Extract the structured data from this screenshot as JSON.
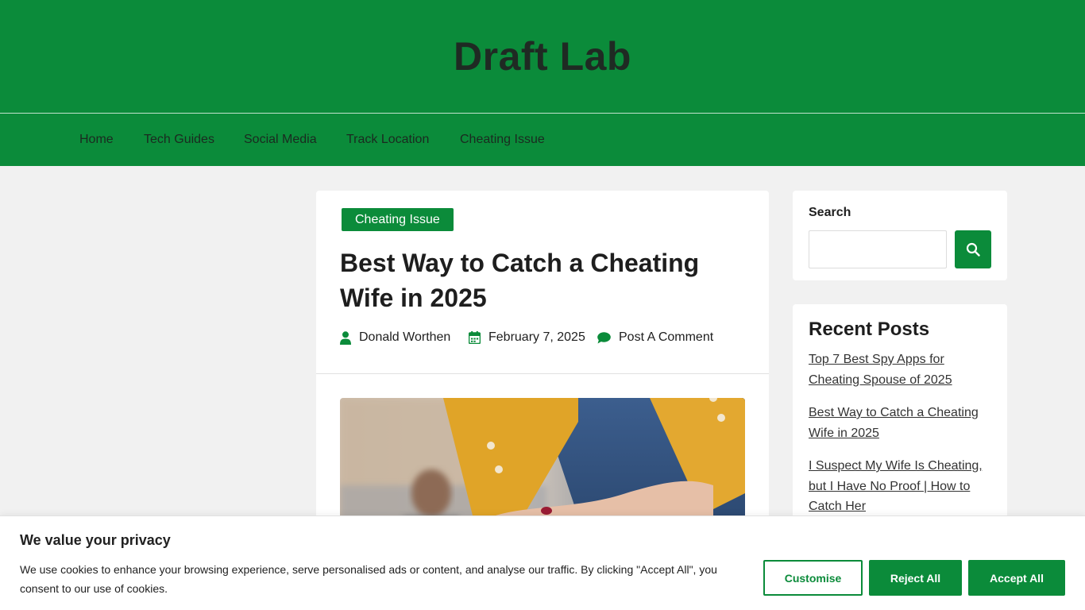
{
  "site": {
    "title": "Draft Lab"
  },
  "nav": {
    "items": [
      {
        "label": "Home"
      },
      {
        "label": "Tech Guides"
      },
      {
        "label": "Social Media"
      },
      {
        "label": "Track Location"
      },
      {
        "label": "Cheating Issue"
      }
    ]
  },
  "post": {
    "category": "Cheating Issue",
    "title": "Best Way to Catch a Cheating Wife in 2025",
    "author": "Donald Worthen",
    "date": "February 7, 2025",
    "comment_link": "Post A Comment",
    "author_icon": "user-icon",
    "date_icon": "calendar-icon",
    "comment_icon": "comment-icon"
  },
  "sidebar": {
    "search": {
      "label": "Search",
      "placeholder": "",
      "button_icon": "search-icon"
    },
    "recent": {
      "title": "Recent Posts",
      "items": [
        {
          "label": "Top 7 Best Spy Apps for Cheating Spouse of 2025"
        },
        {
          "label": "Best Way to Catch a Cheating Wife in 2025"
        },
        {
          "label": "I Suspect My Wife Is Cheating, but I Have No Proof | How to Catch Her"
        }
      ]
    }
  },
  "cookie": {
    "title": "We value your privacy",
    "text": "We use cookies to enhance your browsing experience, serve personalised ads or content, and analyse our traffic. By clicking \"Accept All\", you consent to our use of cookies.",
    "customise_label": "Customise",
    "reject_label": "Reject All",
    "accept_label": "Accept All"
  },
  "colors": {
    "brand": "#0b8b3a",
    "background": "#f1f1f1",
    "text": "#1e1e1e"
  }
}
